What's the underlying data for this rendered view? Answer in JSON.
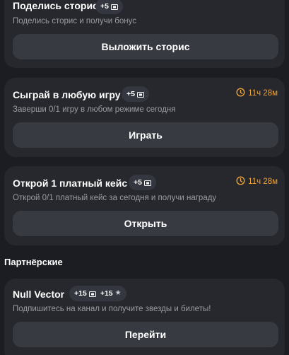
{
  "tasks": [
    {
      "title": "Поделись сторис",
      "badge": "+5",
      "description": "Поделись сторис и получи бонус",
      "button": "Выложить сторис"
    },
    {
      "title": "Сыграй в любую игру",
      "badge": "+5",
      "timer": "11ч 28м",
      "description": "Заверши 0/1 игру в любом режиме сегодня",
      "button": "Играть"
    },
    {
      "title": "Открой 1 платный кейс",
      "badge": "+5",
      "timer": "11ч 28м",
      "description": "Открой 0/1 платный кейс за сегодня и получи награду",
      "button": "Открыть"
    }
  ],
  "partners": {
    "heading": "Партнёрские",
    "items": [
      {
        "title": "Null Vector",
        "badge_tickets": "+15",
        "badge_stars": "+15",
        "description": "Подпишитесь на канал и получите звезды и билеты!",
        "button": "Перейти"
      }
    ]
  },
  "colors": {
    "background": "#1b1d22",
    "card": "#26282d",
    "button": "#373a41",
    "badge": "#34373f",
    "timer": "#f0a43a",
    "muted_text": "#9a9ca3"
  },
  "icons": {
    "ticket": "ticket-icon",
    "star": "star-icon",
    "timer": "timer-icon"
  }
}
